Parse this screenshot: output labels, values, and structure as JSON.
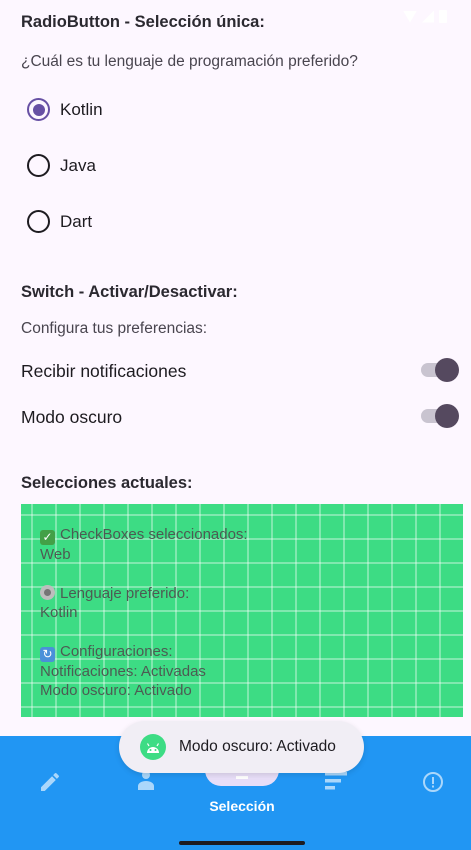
{
  "colors": {
    "accent": "#6750a4",
    "summary_background": "#3ddc84",
    "bottom_nav": "#2196f3",
    "switch_thumb": "#55495f"
  },
  "radio_section": {
    "title": "RadioButton - Selección única:",
    "question": "¿Cuál es tu lenguaje de programación preferido?",
    "options": [
      {
        "label": "Kotlin",
        "selected": true
      },
      {
        "label": "Java",
        "selected": false
      },
      {
        "label": "Dart",
        "selected": false
      }
    ]
  },
  "switch_section": {
    "title": "Switch - Activar/Desactivar:",
    "subtitle": "Configura tus preferencias:",
    "items": [
      {
        "label": "Recibir notificaciones",
        "checked": true
      },
      {
        "label": "Modo oscuro",
        "checked": true
      }
    ]
  },
  "summary": {
    "title": "Selecciones actuales:",
    "checkboxes_heading": "CheckBoxes seleccionados:",
    "checkboxes_value": "Web",
    "language_heading": "Lenguaje preferido:",
    "language_value": "Kotlin",
    "config_heading": "Configuraciones:",
    "config_notifications": "Notificaciones: Activadas",
    "config_dark_mode": "Modo oscuro: Activado"
  },
  "bottom_nav": {
    "items": [
      {
        "icon": "pencil-icon"
      },
      {
        "icon": "person-icon"
      },
      {
        "icon": "selection-icon",
        "label": "Selección",
        "active": true
      },
      {
        "icon": "sort-icon"
      },
      {
        "icon": "info-icon"
      }
    ]
  },
  "toast": {
    "icon": "android-icon",
    "text": "Modo oscuro: Activado"
  }
}
